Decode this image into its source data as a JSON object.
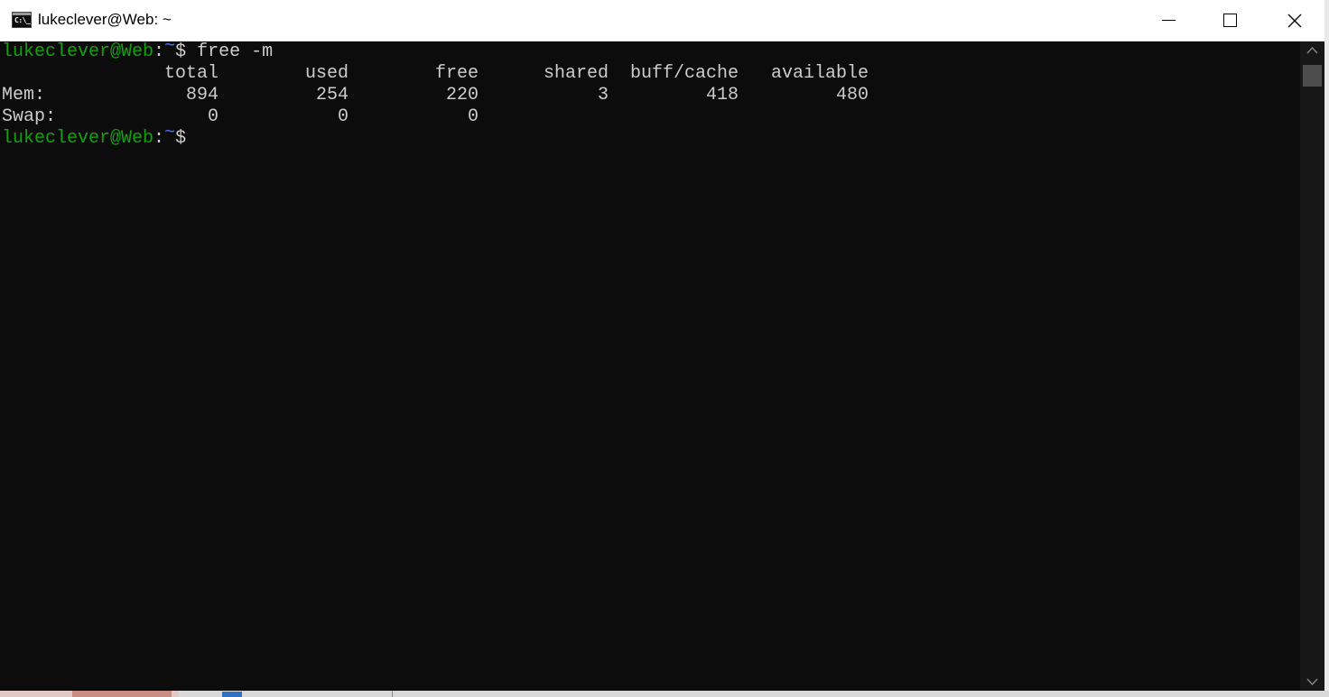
{
  "window": {
    "title": "lukeclever@Web: ~",
    "controls": {
      "minimize": "minimize",
      "maximize": "maximize",
      "close": "close"
    }
  },
  "terminal": {
    "prompt": {
      "user_host": "lukeclever@Web",
      "colon": ":",
      "path": "~",
      "symbol": "$"
    },
    "command": " free -m",
    "table": {
      "headers": [
        "total",
        "used",
        "free",
        "shared",
        "buff/cache",
        "available"
      ],
      "rows": [
        {
          "label": "Mem:",
          "values": [
            "894",
            "254",
            "220",
            "3",
            "418",
            "480"
          ]
        },
        {
          "label": "Swap:",
          "values": [
            "0",
            "0",
            "0",
            "",
            "",
            ""
          ]
        }
      ]
    }
  },
  "colors": {
    "background": "#0c0c0c",
    "text": "#cccccc",
    "prompt_user": "#13a10e",
    "prompt_path": "#3b78ff"
  },
  "icons": {
    "app": "console-icon",
    "minimize": "minimize-icon",
    "maximize": "maximize-icon",
    "close": "close-icon",
    "scroll_up": "chevron-up-icon",
    "scroll_down": "chevron-down-icon"
  }
}
